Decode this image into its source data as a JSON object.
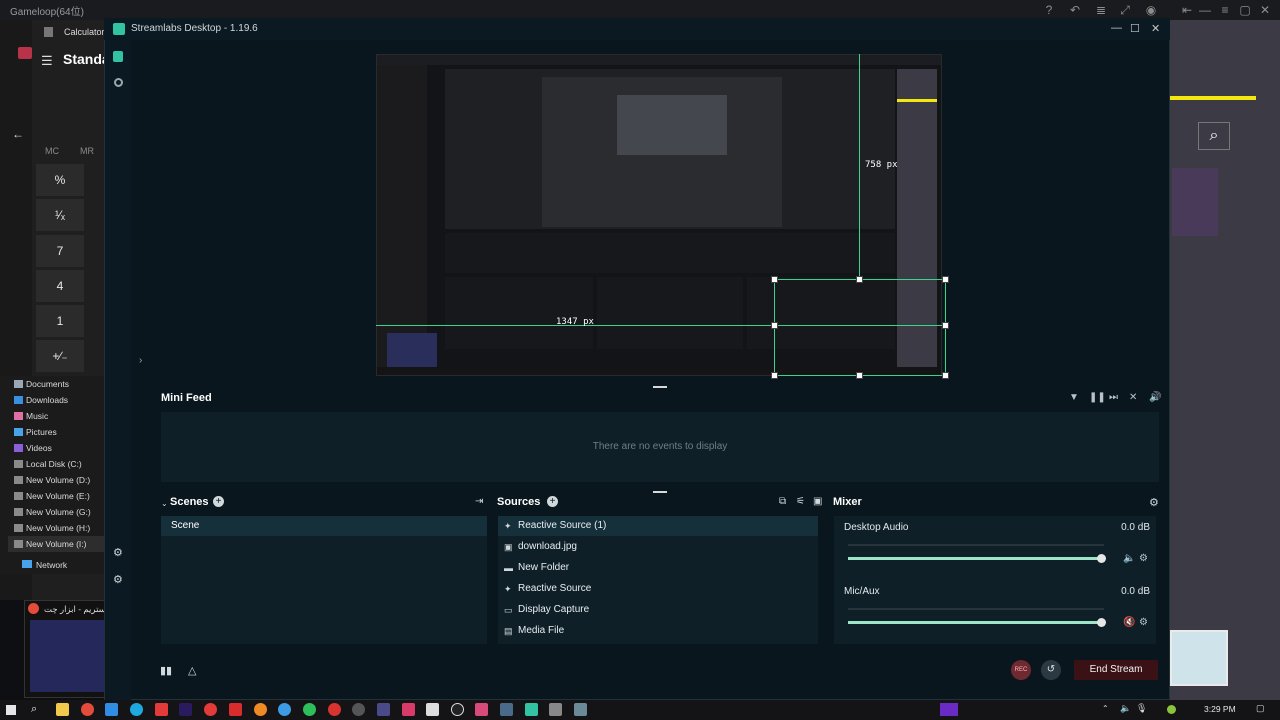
{
  "gameloop": {
    "title": "Gameloop(64位)"
  },
  "calculator": {
    "title": "Calculator",
    "mode": "Standa",
    "memory": [
      "MC",
      "MR"
    ],
    "keys": [
      "%",
      "¹⁄ₓ",
      "7",
      "4",
      "1",
      "+∕₋"
    ]
  },
  "explorer": {
    "items": [
      "Documents",
      "Downloads",
      "Music",
      "Pictures",
      "Videos",
      "Local Disk (C:)",
      "New Volume (D:)",
      "New Volume (E:)",
      "New Volume (G:)",
      "New Volume (H:)",
      "New Volume (I:)",
      "Network"
    ]
  },
  "chrome": {
    "label": "مستراستریم - ابزار چت - Goo..."
  },
  "streamlabs": {
    "title": "Streamlabs Desktop - 1.19.6",
    "preview": {
      "dim_w": "1347 px",
      "dim_h": "758 px"
    },
    "minifeed": {
      "title": "Mini Feed",
      "empty": "There are no events to display"
    },
    "scenes": {
      "title": "Scenes",
      "items": [
        "Scene"
      ]
    },
    "sources": {
      "title": "Sources",
      "items": [
        {
          "label": "Reactive Source (1)",
          "icon": "reactive-icon"
        },
        {
          "label": "download.jpg",
          "icon": "image-icon"
        },
        {
          "label": "New Folder",
          "icon": "folder-icon"
        },
        {
          "label": "Reactive Source",
          "icon": "reactive-icon"
        },
        {
          "label": "Display Capture",
          "icon": "monitor-icon"
        },
        {
          "label": "Media File",
          "icon": "media-icon"
        }
      ]
    },
    "mixer": {
      "title": "Mixer",
      "channels": [
        {
          "name": "Desktop Audio",
          "db": "0.0 dB",
          "level": 0.99
        },
        {
          "name": "Mic/Aux",
          "db": "0.0 dB",
          "level": 0.99
        }
      ]
    },
    "footer": {
      "end_stream": "End Stream",
      "rec": "REC"
    }
  },
  "taskbar": {
    "clock": "3:29 PM"
  },
  "colors": {
    "accent": "#31c3a2",
    "guide": "#3ad48a",
    "end_stream": "#3a1216"
  }
}
